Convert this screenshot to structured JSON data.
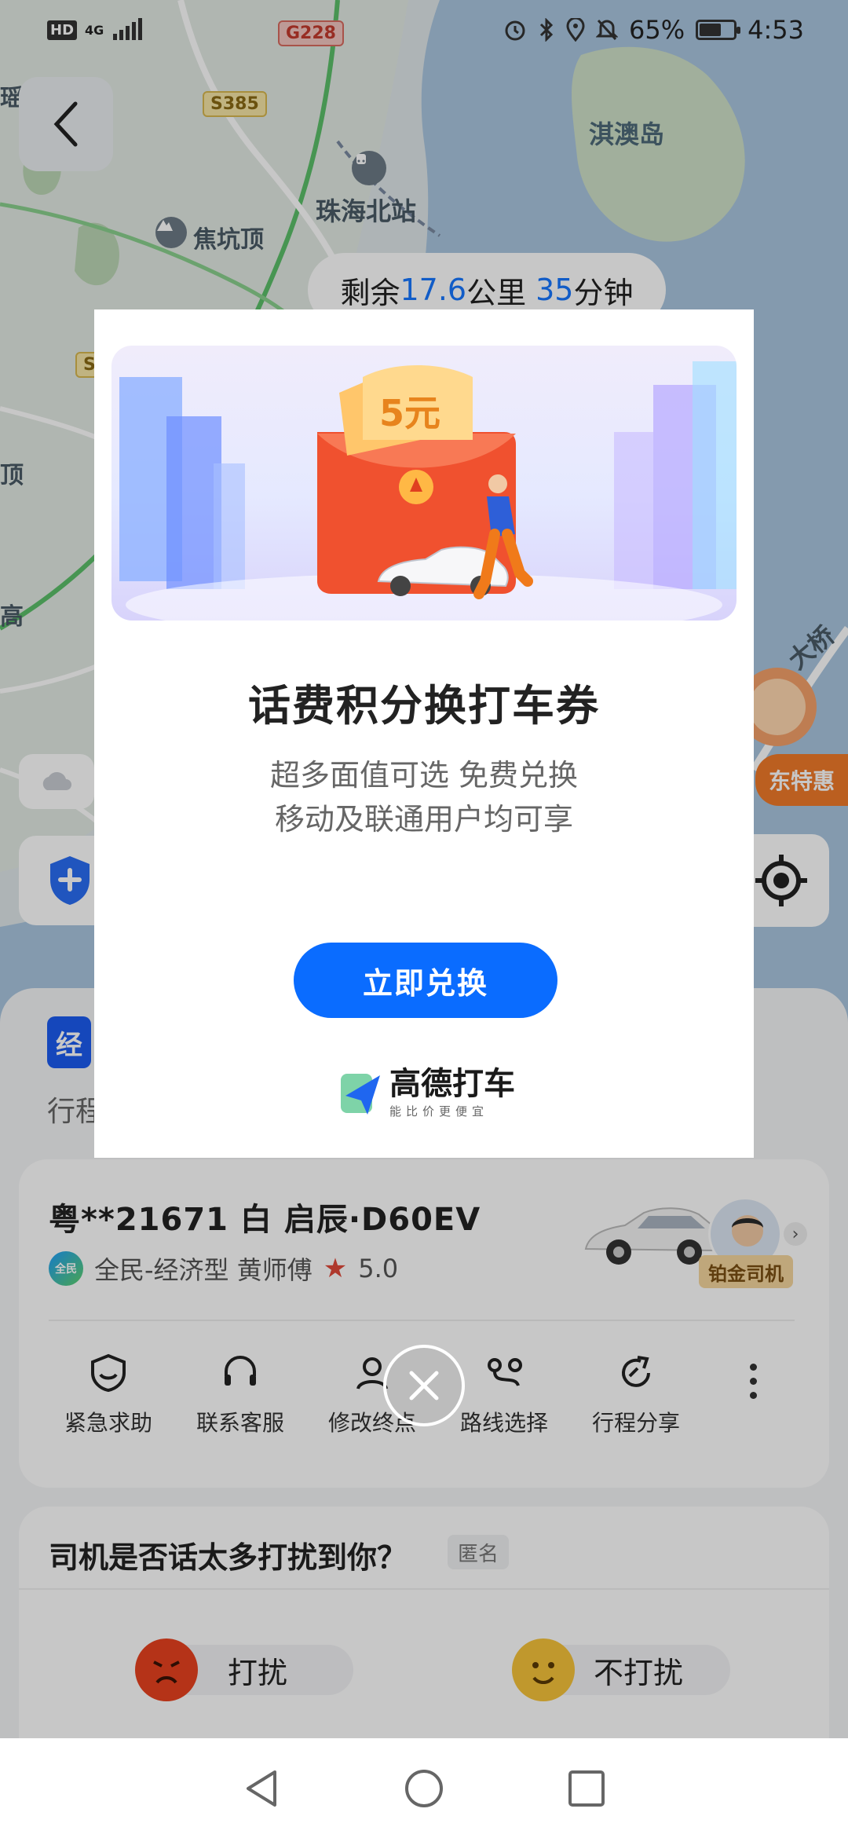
{
  "status_bar": {
    "hd": "HD",
    "network": "4G",
    "battery_pct": "65%",
    "battery_level": 0.65,
    "time": "4:53",
    "icons": [
      "alarm-icon",
      "bluetooth-icon",
      "location-icon",
      "mute-icon"
    ]
  },
  "map": {
    "labels": {
      "island": "淇澳岛",
      "station": "珠海北站",
      "peak": "焦坑顶",
      "left_top": "瑶",
      "left_mid": "顶",
      "left_low": "高"
    },
    "roads": {
      "g228": "G228",
      "s385": "S385",
      "s_small": "S"
    },
    "eta": {
      "prefix": "剩余",
      "distance": "17.6",
      "dist_unit": "公里",
      "minutes": "35",
      "min_unit": "分钟"
    },
    "promo": {
      "road_text": "大桥",
      "promo_text": "东特惠"
    },
    "colors": {
      "land": "#dfe7ea",
      "sea": "#a9c6df",
      "road": "#ffffff",
      "highlight_road": "#5cbf6a"
    }
  },
  "trip": {
    "service_tag": "经",
    "trip_label": "行程"
  },
  "driver": {
    "plate_line": "粤**21671  白  启辰·D60EV",
    "brand_badge": "全民",
    "service_line": "全民-经济型 黄师傅",
    "rating": "5.0",
    "badge": "铂金司机"
  },
  "actions": [
    {
      "label": "紧急求助",
      "icon": "shield-help-icon"
    },
    {
      "label": "联系客服",
      "icon": "headset-icon"
    },
    {
      "label": "修改终点",
      "icon": "edit-destination-icon"
    },
    {
      "label": "路线选择",
      "icon": "route-icon"
    },
    {
      "label": "行程分享",
      "icon": "share-icon"
    }
  ],
  "survey": {
    "question": "司机是否话太多打扰到你？",
    "anon": "匿名",
    "option_disturb": "打扰",
    "option_ok": "不打扰"
  },
  "modal": {
    "coupon_value": "5元",
    "title": "话费积分换打车券",
    "subtitle_1": "超多面值可选 免费兑换",
    "subtitle_2": "移动及联通用户均可享",
    "cta": "立即兑换",
    "logo_name": "高德打车",
    "logo_slogan": "能比价更便宜",
    "accent": "#0a6cff"
  }
}
